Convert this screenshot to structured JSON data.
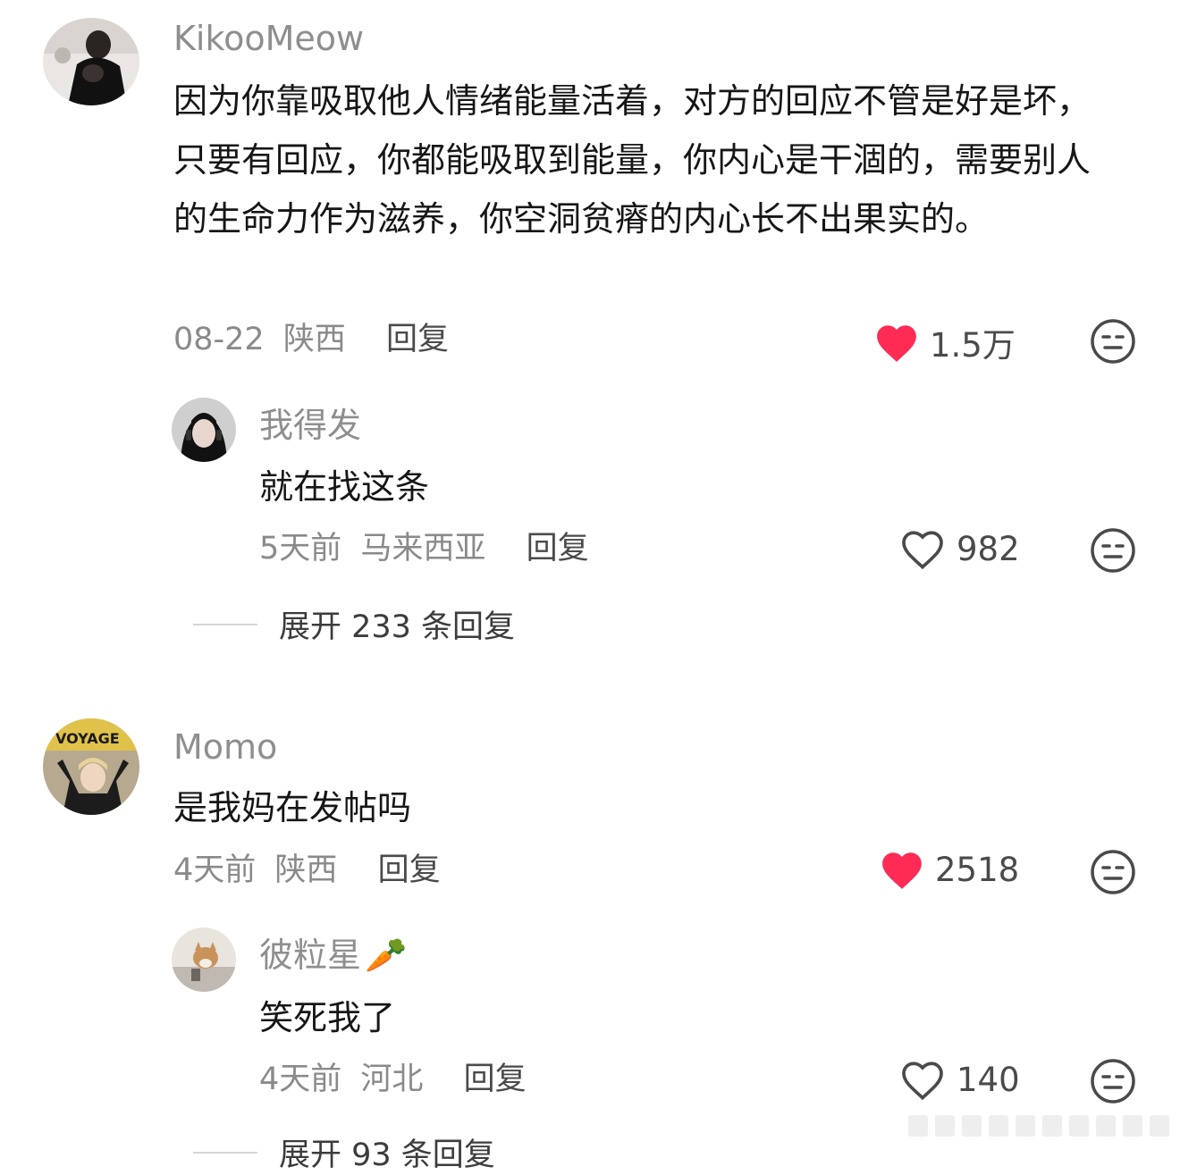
{
  "comments": [
    {
      "username": "KikooMeow",
      "text": "因为你靠吸取他人情绪能量活着，对方的回应不管是好是坏，只要有回应，你都能吸取到能量，你内心是干涸的，需要别人的生命力作为滋养，你空洞贫瘠的内心长不出果实的。",
      "date": "08-22",
      "location": "陕西",
      "reply_label": "回复",
      "likes": "1.5万",
      "liked": true,
      "avatar_icon": "photo-avatar-dark",
      "replies": [
        {
          "username": "我得发",
          "text": "就在找这条",
          "date": "5天前",
          "location": "马来西亚",
          "reply_label": "回复",
          "likes": "982",
          "liked": false,
          "avatar_icon": "photo-avatar-headset"
        }
      ],
      "expand_label": "展开 233 条回复"
    },
    {
      "username": "Momo",
      "text": "是我妈在发帖吗",
      "date": "4天前",
      "location": "陕西",
      "reply_label": "回复",
      "likes": "2518",
      "liked": true,
      "avatar_icon": "photo-avatar-voyage",
      "replies": [
        {
          "username": "彼粒星",
          "username_emoji": "🥕",
          "text": "笑死我了",
          "date": "4天前",
          "location": "河北",
          "reply_label": "回复",
          "likes": "140",
          "liked": false,
          "avatar_icon": "photo-avatar-cat"
        }
      ],
      "expand_label": "展开 93 条回复"
    }
  ],
  "colors": {
    "heart_liked": "#fe2c55",
    "text_primary": "#161616",
    "text_secondary": "#8a8a8a"
  }
}
